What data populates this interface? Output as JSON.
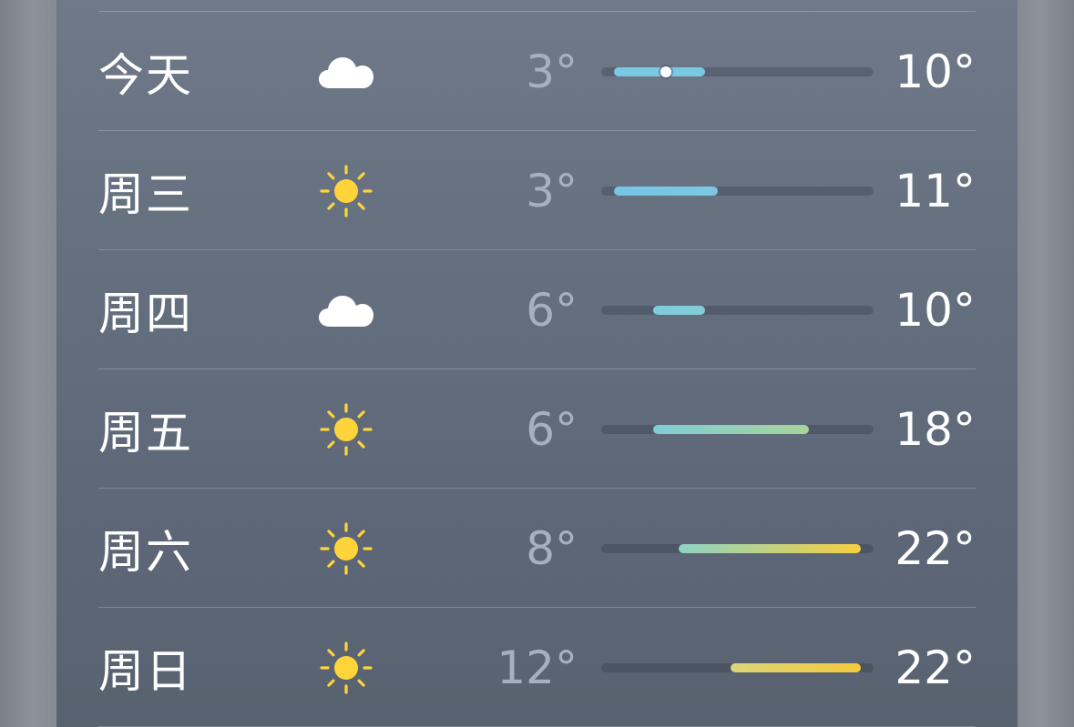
{
  "range": {
    "min": 2,
    "max": 23
  },
  "days": [
    {
      "label": "今天",
      "icon": "cloud-icon",
      "low": 3,
      "high": 10,
      "low_text": "3°",
      "high_text": "10°",
      "current": 7,
      "gradient": [
        "#7ac8e4",
        "#7ac8e4"
      ]
    },
    {
      "label": "周三",
      "icon": "sun-icon",
      "low": 3,
      "high": 11,
      "low_text": "3°",
      "high_text": "11°",
      "gradient": [
        "#76c5e6",
        "#7ac8e3"
      ]
    },
    {
      "label": "周四",
      "icon": "cloud-icon",
      "low": 6,
      "high": 10,
      "low_text": "6°",
      "high_text": "10°",
      "gradient": [
        "#7fcbdc",
        "#82ccd8"
      ]
    },
    {
      "label": "周五",
      "icon": "sun-icon",
      "low": 6,
      "high": 18,
      "low_text": "6°",
      "high_text": "18°",
      "gradient": [
        "#7fcdd6",
        "#a8d398"
      ]
    },
    {
      "label": "周六",
      "icon": "sun-icon",
      "low": 8,
      "high": 22,
      "low_text": "8°",
      "high_text": "22°",
      "gradient": [
        "#8ed3c4",
        "#f6cf3f"
      ]
    },
    {
      "label": "周日",
      "icon": "sun-icon",
      "low": 12,
      "high": 22,
      "low_text": "12°",
      "high_text": "22°",
      "gradient": [
        "#dbd577",
        "#f5c93c"
      ]
    }
  ],
  "colors": {
    "sun": "#ffd43b",
    "cloud": "#ffffff"
  }
}
